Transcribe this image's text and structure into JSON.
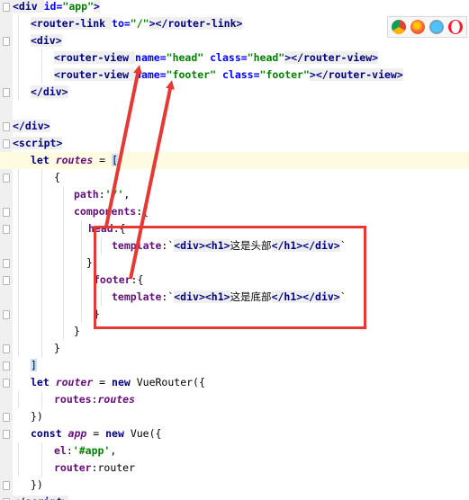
{
  "editor": {
    "lines": [
      [
        {
          "t": "<div ",
          "c": "tag"
        },
        {
          "t": "id=",
          "c": "attr"
        },
        {
          "t": "\"app\"",
          "c": "str"
        },
        {
          "t": ">",
          "c": "tag"
        }
      ],
      [
        {
          "t": "<router-link ",
          "c": "tag"
        },
        {
          "t": "to=",
          "c": "attr"
        },
        {
          "t": "\"/\"",
          "c": "str"
        },
        {
          "t": "></router-link>",
          "c": "tag"
        }
      ],
      [
        {
          "t": "<div>",
          "c": "tag"
        }
      ],
      [
        {
          "t": "<router-view ",
          "c": "tag"
        },
        {
          "t": "name=",
          "c": "attr"
        },
        {
          "t": "\"head\"",
          "c": "str"
        },
        {
          "t": " ",
          "c": "plain"
        },
        {
          "t": "class=",
          "c": "attr"
        },
        {
          "t": "\"head\"",
          "c": "str"
        },
        {
          "t": "></router-view>",
          "c": "tag"
        }
      ],
      [
        {
          "t": "<router-view ",
          "c": "tag"
        },
        {
          "t": "name=",
          "c": "attr"
        },
        {
          "t": "\"footer\"",
          "c": "str"
        },
        {
          "t": " ",
          "c": "plain"
        },
        {
          "t": "class=",
          "c": "attr"
        },
        {
          "t": "\"footer\"",
          "c": "str"
        },
        {
          "t": "></router-view>",
          "c": "tag"
        }
      ],
      [
        {
          "t": "</div>",
          "c": "tag"
        }
      ],
      [],
      [
        {
          "t": "</div>",
          "c": "tag"
        }
      ],
      [
        {
          "t": "<script>",
          "c": "tag"
        }
      ],
      [
        {
          "t": "let ",
          "c": "kw"
        },
        {
          "t": "routes",
          "c": "var"
        },
        {
          "t": " = ",
          "c": "plain"
        },
        {
          "t": "[",
          "c": "brk"
        }
      ],
      [
        {
          "t": "{",
          "c": "plain"
        }
      ],
      [
        {
          "t": "path",
          "c": "prop"
        },
        {
          "t": ":",
          "c": "plain"
        },
        {
          "t": "'/'",
          "c": "str"
        },
        {
          "t": ",",
          "c": "plain"
        }
      ],
      [
        {
          "t": "components",
          "c": "prop"
        },
        {
          "t": ":{",
          "c": "plain"
        }
      ],
      [
        {
          "t": "head",
          "c": "prop"
        },
        {
          "t": ":{",
          "c": "plain"
        }
      ],
      [
        {
          "t": "template",
          "c": "prop"
        },
        {
          "t": ":`",
          "c": "plain"
        },
        {
          "t": "<div><h1>",
          "c": "tpl"
        },
        {
          "t": "这是头部",
          "c": "cn"
        },
        {
          "t": "</h1></div>",
          "c": "tpl"
        },
        {
          "t": "`",
          "c": "plain"
        }
      ],
      [
        {
          "t": "},",
          "c": "plain"
        }
      ],
      [
        {
          "t": "footer",
          "c": "prop"
        },
        {
          "t": ":{",
          "c": "plain"
        }
      ],
      [
        {
          "t": "template",
          "c": "prop"
        },
        {
          "t": ":`",
          "c": "plain"
        },
        {
          "t": "<div><h1>",
          "c": "tpl"
        },
        {
          "t": "这是底部",
          "c": "cn"
        },
        {
          "t": "</h1></div>",
          "c": "tpl"
        },
        {
          "t": "`",
          "c": "plain"
        }
      ],
      [
        {
          "t": "}",
          "c": "plain"
        }
      ],
      [
        {
          "t": "}",
          "c": "plain"
        }
      ],
      [
        {
          "t": "}",
          "c": "plain"
        }
      ],
      [
        {
          "t": "]",
          "c": "brk"
        }
      ],
      [
        {
          "t": "let ",
          "c": "kw"
        },
        {
          "t": "router",
          "c": "var"
        },
        {
          "t": " = ",
          "c": "plain"
        },
        {
          "t": "new ",
          "c": "kw"
        },
        {
          "t": "VueRouter({",
          "c": "plain"
        }
      ],
      [
        {
          "t": "routes",
          "c": "prop"
        },
        {
          "t": ":",
          "c": "plain"
        },
        {
          "t": "routes",
          "c": "var"
        }
      ],
      [
        {
          "t": "})",
          "c": "plain"
        }
      ],
      [
        {
          "t": "const ",
          "c": "kw"
        },
        {
          "t": "app",
          "c": "var"
        },
        {
          "t": " = ",
          "c": "plain"
        },
        {
          "t": "new ",
          "c": "kw"
        },
        {
          "t": "Vue({",
          "c": "plain"
        }
      ],
      [
        {
          "t": "el",
          "c": "prop"
        },
        {
          "t": ":",
          "c": "plain"
        },
        {
          "t": "'#app'",
          "c": "str"
        },
        {
          "t": ",",
          "c": "plain"
        }
      ],
      [
        {
          "t": "router",
          "c": "prop"
        },
        {
          "t": ":",
          "c": "plain"
        },
        {
          "t": "router",
          "c": "plain"
        }
      ],
      [
        {
          "t": "})",
          "c": "plain"
        }
      ],
      [
        {
          "t": "</",
          "c": "tag"
        },
        {
          "t": "script",
          "c": "tag"
        },
        {
          "t": ">",
          "c": "tag"
        }
      ]
    ],
    "highlighted_line": 9,
    "browser_icons": [
      "chrome-icon",
      "firefox-icon",
      "safari-icon",
      "opera-icon"
    ],
    "colors": {
      "tag": "#000080",
      "attribute": "#0000ff",
      "string": "#008000",
      "keyword": "#000080",
      "variable": "#660e7a",
      "annotation": "#e53935",
      "line_highlight": "#fffbe0"
    }
  }
}
